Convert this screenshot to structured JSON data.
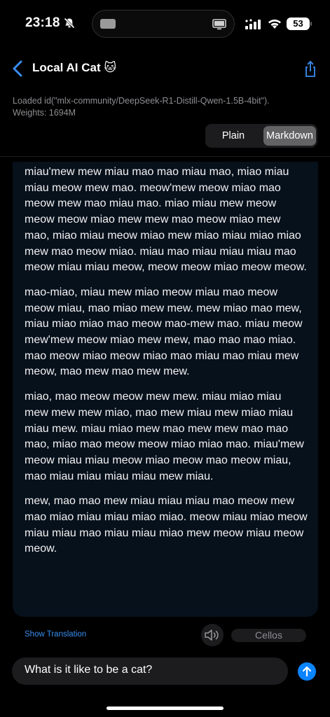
{
  "status_bar": {
    "time": "23:18",
    "battery": "53"
  },
  "nav": {
    "title": "Local AI Cat 🐱"
  },
  "info": {
    "loaded": "Loaded id(\"mlx-community/DeepSeek-R1-Distill-Qwen-1.5B-4bit\").",
    "weights": "Weights: 1694M"
  },
  "segmented": {
    "plain_label": "Plain",
    "markdown_label": "Markdown",
    "selected": "Markdown"
  },
  "content": {
    "paragraphs": [
      "miau'mew mew miau mao mao miau mao, miao miau miau meow mew mao. meow'mew meow miao mao meow mew mao miau mao. miao miau mew meow meow meow miao mew mew mao meow miao mew mao, miao miau meow miao mew miao miau miao miao mew mao meow miao. miau mao miau miau miau mao meow miau miau meow, meow meow miao meow meow.",
      "mao-miao, miau mew miao meow miau mao meow meow miau, mao miao mew mew. mew miao mao mew, miau miao miao mao meow mao-mew mao. miau meow mew'mew meow miao mew mew, mao mao mao miao. mao meow miao meow miao mao miau mao miau mew meow, mao mew mao mew mew.",
      "miao, mao meow meow mew mew. miau miao miau mew mew mew miao, mao mew miau mew miao miau miau mew. miau miao mew mao mew mew mao mao mao, miao mao meow meow miao miao mao. miau'mew meow miau miau meow miao meow mao meow miau, mao miau miau miau miau mew miau.",
      "mew, mao mao mew miau miau miau mao meow mew mao miao miau miau miao miao. meow miau miao meow miau miau mao miau miau miao mew meow miau meow meow."
    ]
  },
  "controls": {
    "show_translation": "Show Translation",
    "voice": "Cellos"
  },
  "input": {
    "value": "What is it like to be a cat?"
  },
  "colors": {
    "accent": "#0a84ff",
    "bubble": "#07111c",
    "background": "#000000"
  }
}
